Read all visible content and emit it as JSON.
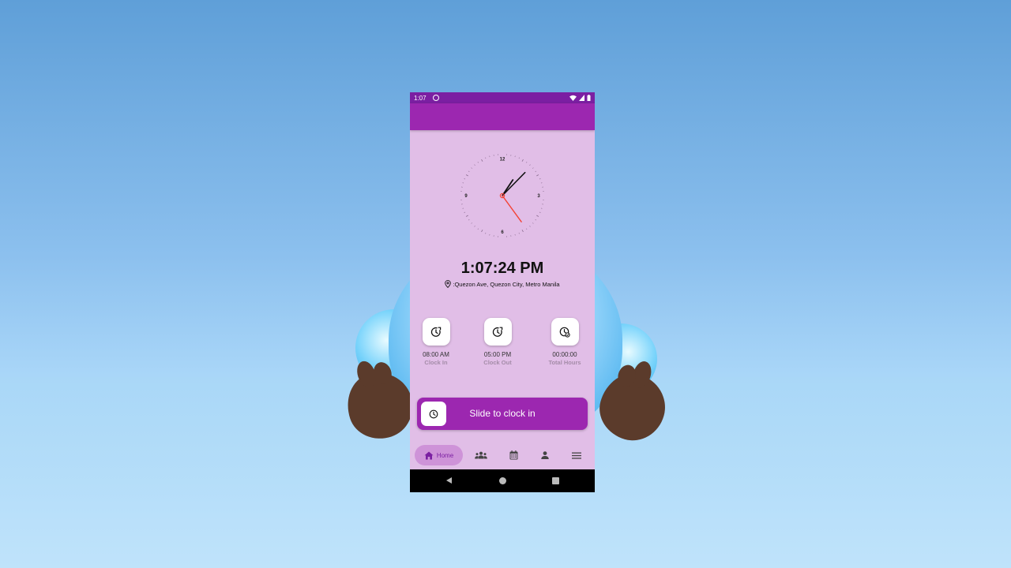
{
  "status_bar": {
    "time": "1:07"
  },
  "clock": {
    "hour": 1,
    "minute": 7,
    "second": 24,
    "numerals": [
      "12",
      "3",
      "6",
      "9"
    ]
  },
  "main": {
    "time": "1:07:24 PM",
    "location": ":Quezon Ave, Quezon City, Metro Manila"
  },
  "stats": [
    {
      "value": "08:00 AM",
      "label": "Clock In",
      "icon": "clock-in-icon"
    },
    {
      "value": "05:00 PM",
      "label": "Clock Out",
      "icon": "clock-out-icon"
    },
    {
      "value": "00:00:00",
      "label": "Total Hours",
      "icon": "total-hours-icon"
    }
  ],
  "slider": {
    "label": "Slide to clock in",
    "icon": "clock-icon"
  },
  "bottom_nav": {
    "items": [
      {
        "label": "Home",
        "icon": "home-icon",
        "active": true
      },
      {
        "label": "",
        "icon": "team-icon"
      },
      {
        "label": "",
        "icon": "calendar-icon"
      },
      {
        "label": "",
        "icon": "person-icon"
      },
      {
        "label": "",
        "icon": "menu-icon"
      }
    ]
  },
  "colors": {
    "primary": "#9c27b0",
    "primary_dark": "#7b1fa2",
    "background": "#e1bee7",
    "nav_active": "#ce93d8",
    "second_hand": "#f44336"
  }
}
